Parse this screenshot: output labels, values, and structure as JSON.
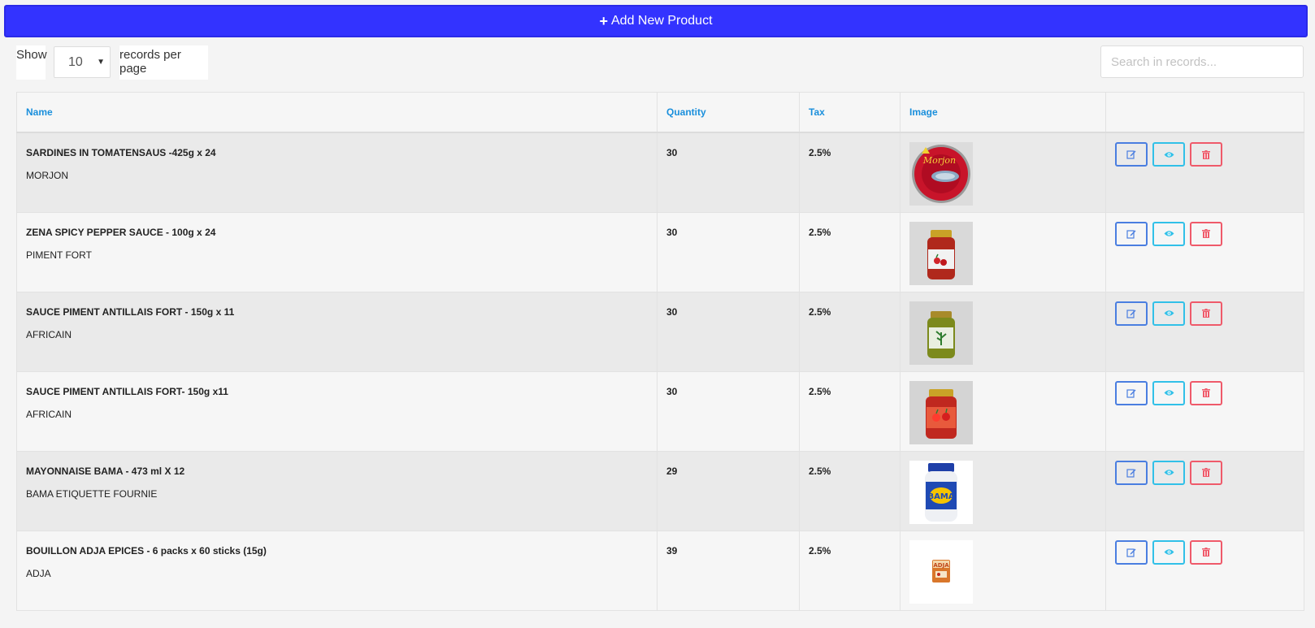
{
  "toolbar": {
    "add_label": "Add New Product"
  },
  "controls": {
    "show_label": "Show",
    "per_page_value": "10",
    "records_label": "records per page",
    "search_placeholder": "Search in records..."
  },
  "table": {
    "headers": {
      "name": "Name",
      "quantity": "Quantity",
      "tax": "Tax",
      "image": "Image"
    },
    "rows": [
      {
        "name": "SARDINES IN TOMATENSAUS -425g x 24",
        "brand": "MORJON",
        "quantity": "30",
        "tax": "2.5%"
      },
      {
        "name": "ZENA SPICY PEPPER SAUCE - 100g x 24",
        "brand": "PIMENT FORT",
        "quantity": "30",
        "tax": "2.5%"
      },
      {
        "name": "SAUCE PIMENT ANTILLAIS FORT - 150g x 11",
        "brand": "AFRICAIN",
        "quantity": "30",
        "tax": "2.5%"
      },
      {
        "name": "SAUCE PIMENT ANTILLAIS FORT- 150g x11",
        "brand": "AFRICAIN",
        "quantity": "30",
        "tax": "2.5%"
      },
      {
        "name": "MAYONNAISE BAMA - 473 ml X 12",
        "brand": "BAMA ETIQUETTE FOURNIE",
        "quantity": "29",
        "tax": "2.5%"
      },
      {
        "name": "BOUILLON ADJA EPICES - 6 packs x 60 sticks (15g)",
        "brand": "ADJA",
        "quantity": "39",
        "tax": "2.5%"
      }
    ]
  },
  "image_logos": {
    "can": "Morjon",
    "bama": "BAMA",
    "adja": "ADJA"
  },
  "icons": {
    "add": "plus-icon",
    "edit": "edit-icon",
    "view": "eye-icon",
    "delete": "trash-icon",
    "dropdown": "caret-down-icon"
  },
  "colors": {
    "primary": "#3333ff",
    "link_header": "#1a8fdc",
    "edit": "#4a7ee0",
    "view": "#31c0e8",
    "delete": "#ef5a6a"
  }
}
